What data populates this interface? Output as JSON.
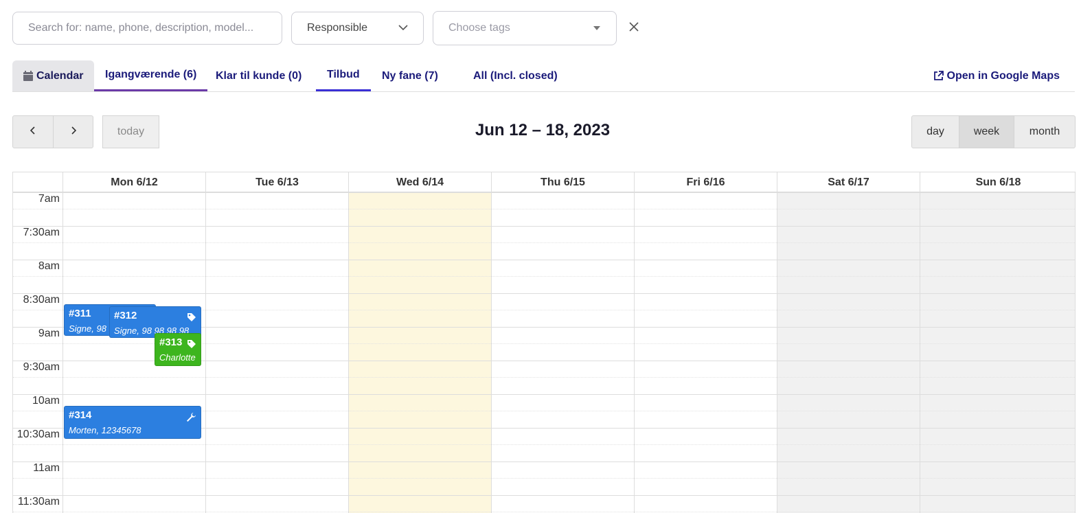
{
  "filters": {
    "search_placeholder": "Search for: name, phone, description, model...",
    "responsible_label": "Responsible",
    "tags_placeholder": "Choose tags"
  },
  "tabs": [
    {
      "label": "Calendar",
      "icon": "calendar-icon"
    },
    {
      "label": "Igangværende (6)"
    },
    {
      "label": "Klar til kunde (0)"
    },
    {
      "label": "Tilbud"
    },
    {
      "label": "Ny fane (7)"
    },
    {
      "label": "All (Incl. closed)"
    }
  ],
  "maps_link": "Open in Google Maps",
  "toolbar": {
    "prev": "‹",
    "next": "›",
    "today": "today",
    "title": "Jun 12 – 18, 2023",
    "views": [
      "day",
      "week",
      "month"
    ],
    "active_view": "week"
  },
  "days": [
    "Mon 6/12",
    "Tue 6/13",
    "Wed 6/14",
    "Thu 6/15",
    "Fri 6/16",
    "Sat 6/17",
    "Sun 6/18"
  ],
  "times": [
    "7am",
    "7:30am",
    "8am",
    "8:30am",
    "9am",
    "9:30am",
    "10am",
    "10:30am",
    "11am",
    "11:30am"
  ],
  "events": [
    {
      "number": "#311",
      "desc": "Signe, 98 98 98 98",
      "color": "#2c7fe0",
      "icon": ""
    },
    {
      "number": "#312",
      "desc": "Signe, 98 98 98 98",
      "color": "#2c7fe0",
      "icon": "tag-icon"
    },
    {
      "number": "#313",
      "desc": "Charlotte",
      "color": "#3db51e",
      "icon": "tag-icon"
    },
    {
      "number": "#314",
      "desc": "Morten, 12345678",
      "color": "#2c7fe0",
      "icon": "wrench-icon"
    }
  ],
  "colors": {
    "today_column": "#fdf7de",
    "weekend_column": "#f1f1f1",
    "tab_text": "#1a1a7a"
  }
}
